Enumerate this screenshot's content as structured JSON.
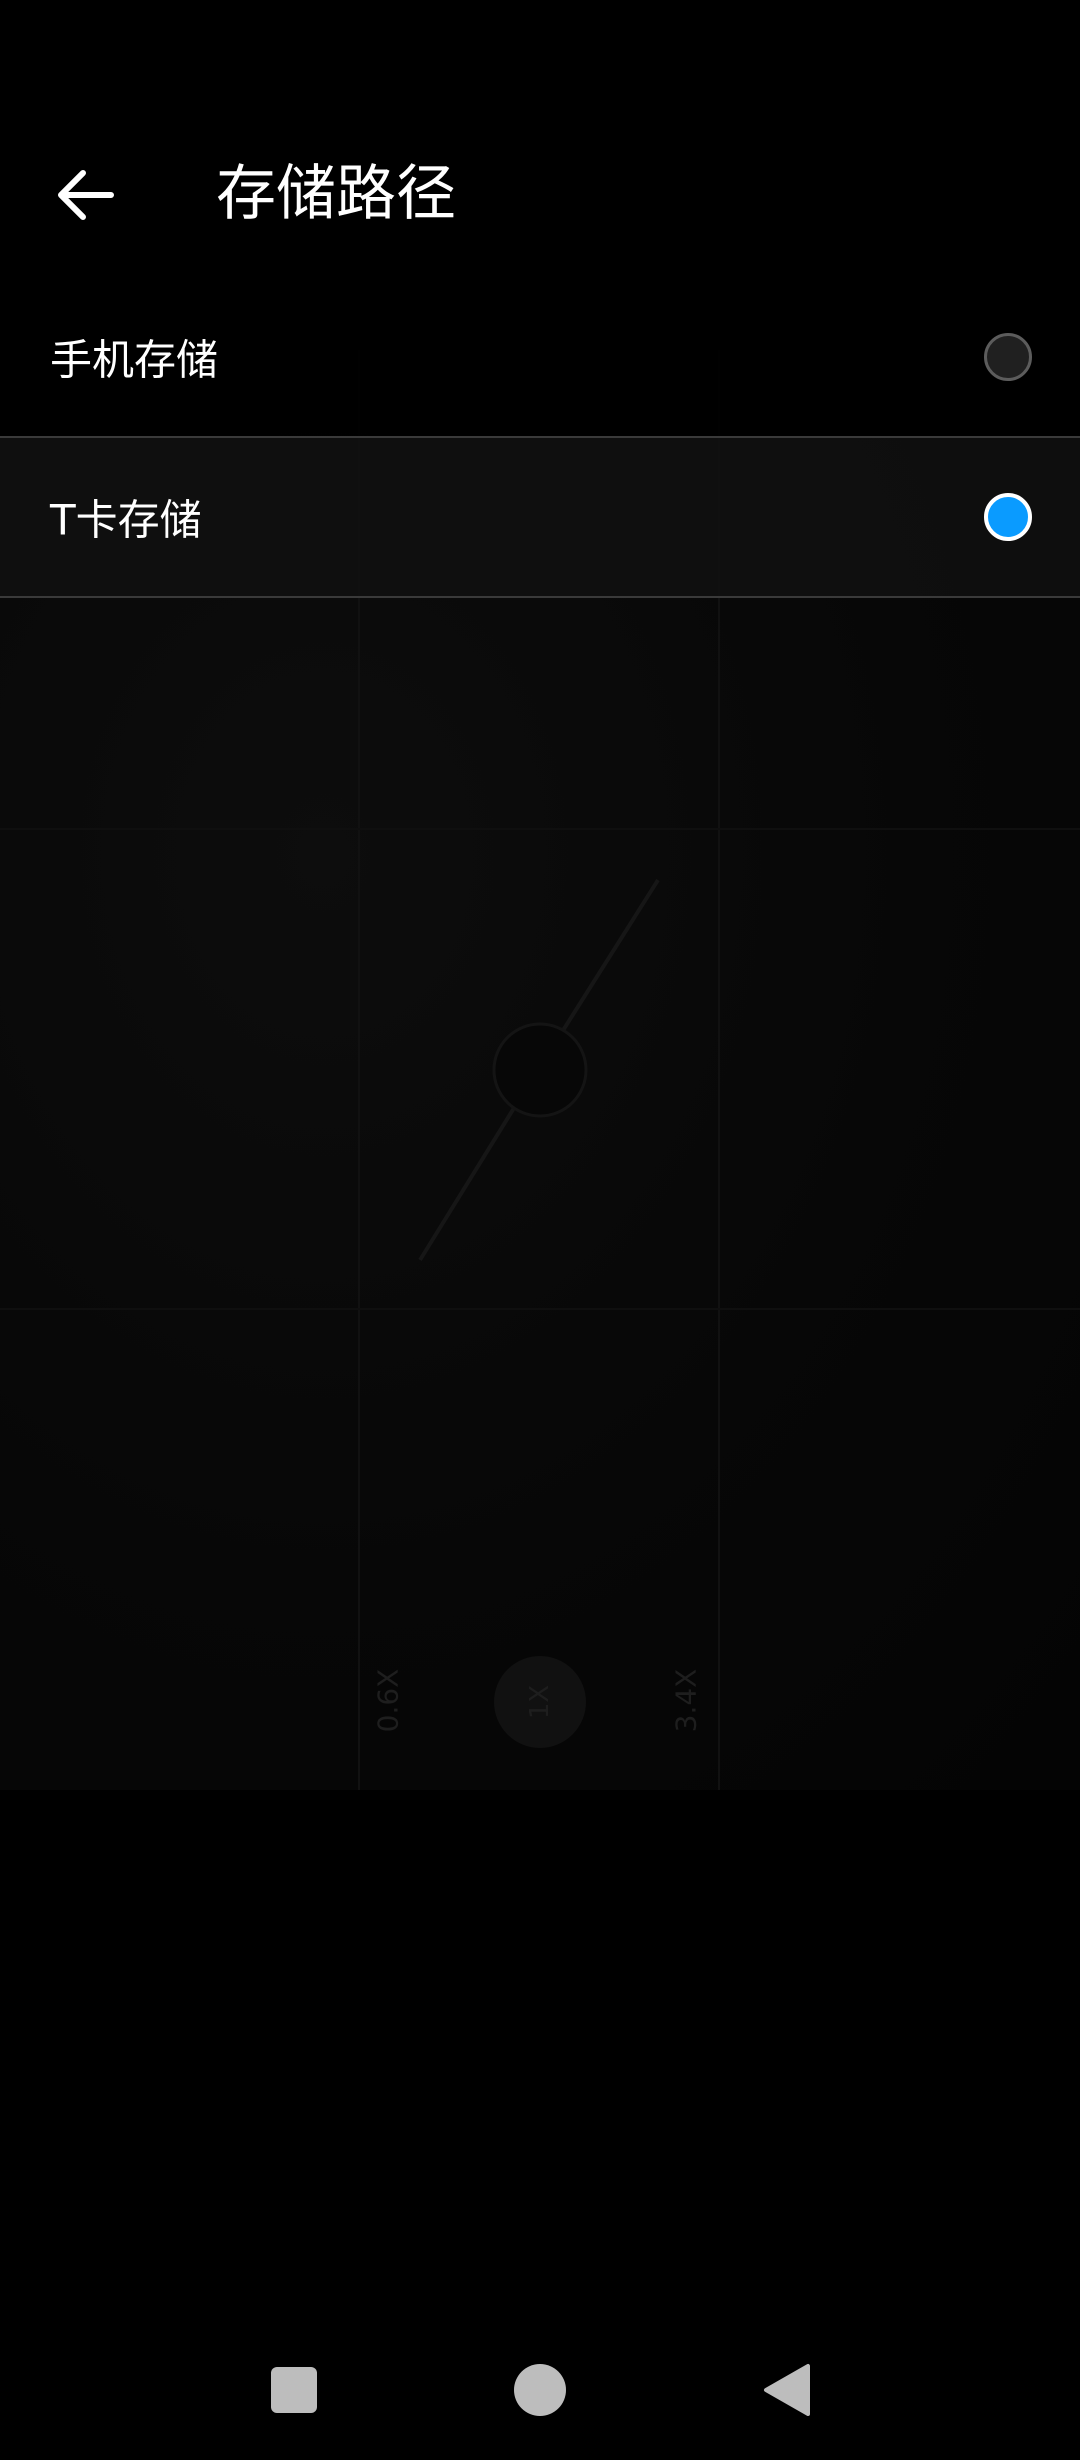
{
  "header": {
    "title": "存储路径",
    "back_icon": "arrow-left-icon"
  },
  "options": [
    {
      "label": "手机存储",
      "selected": false
    },
    {
      "label": "T卡存储",
      "selected": true
    }
  ],
  "camera_preview": {
    "zoom_levels": [
      "0.6X",
      "1X",
      "3.4X"
    ]
  },
  "navbar": {
    "recents_icon": "square-icon",
    "home_icon": "circle-icon",
    "back_icon": "triangle-back-icon"
  },
  "colors": {
    "background": "#000000",
    "accent": "#0a9bff",
    "text": "#ffffff",
    "divider": "#3a3a3a"
  }
}
